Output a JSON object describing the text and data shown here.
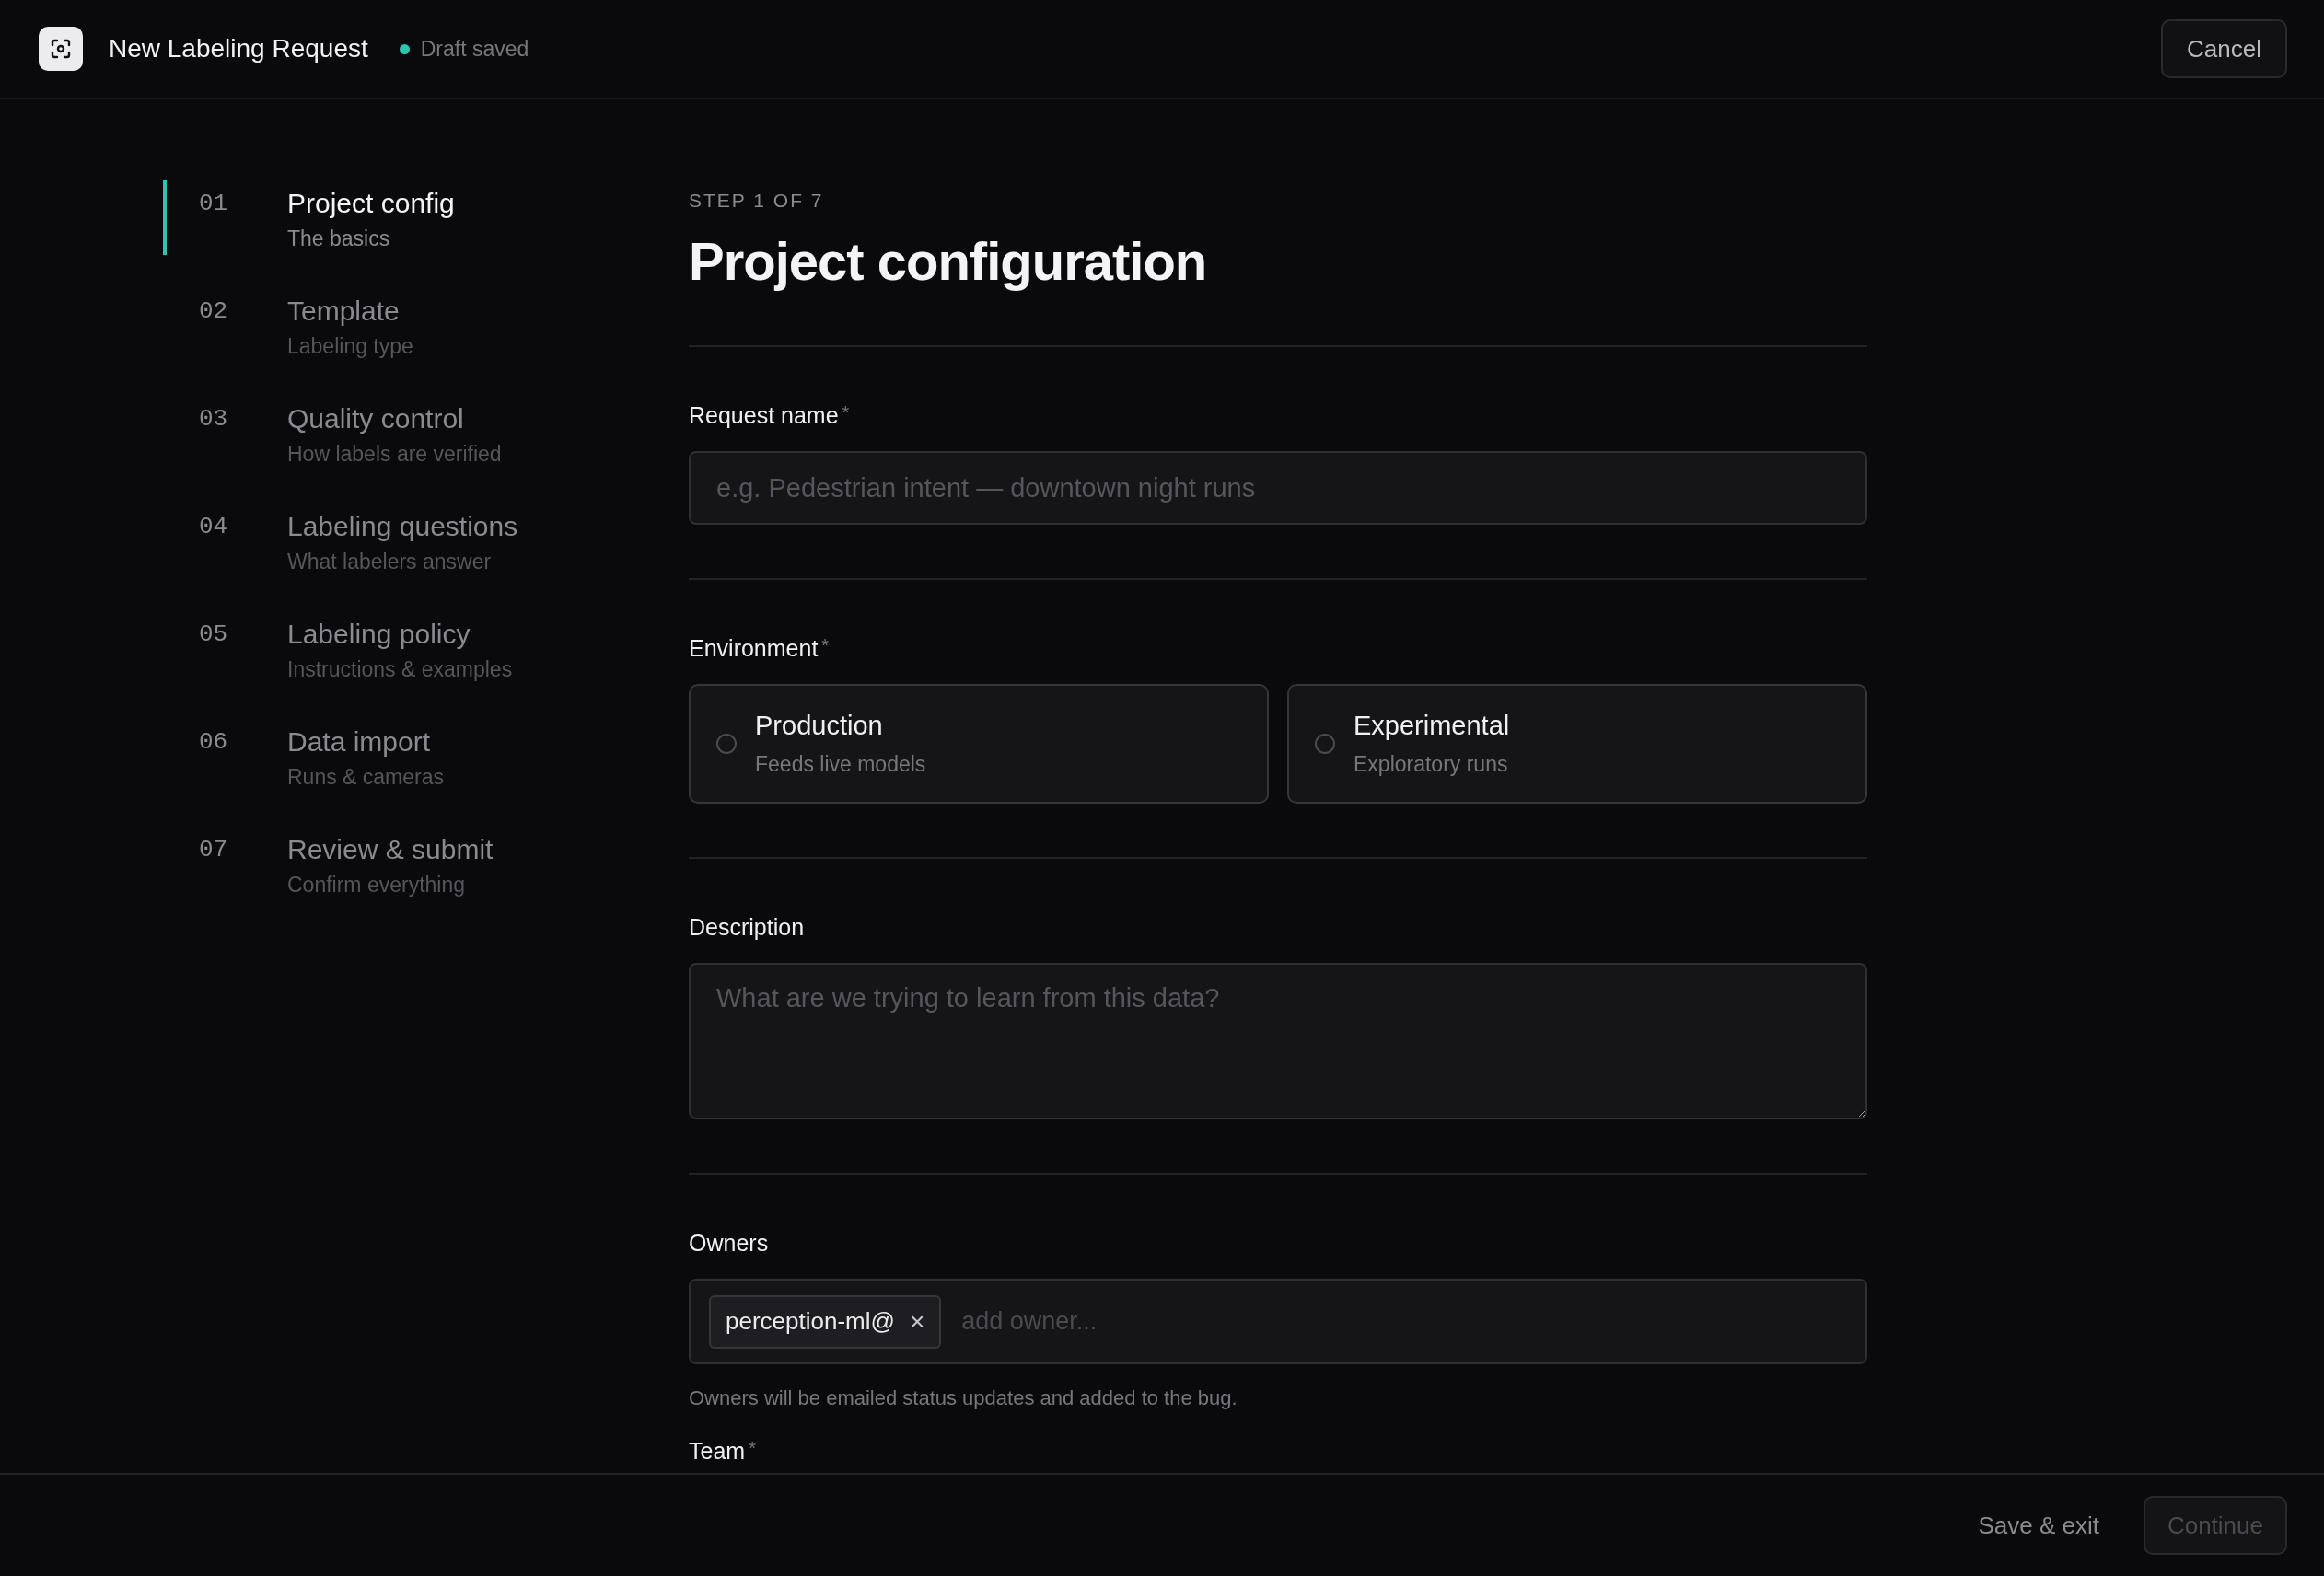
{
  "header": {
    "title": "New Labeling Request",
    "status": "Draft saved",
    "cancel": "Cancel"
  },
  "steps": [
    {
      "number": "01",
      "title": "Project config",
      "subtitle": "The basics",
      "selected": true
    },
    {
      "number": "02",
      "title": "Template",
      "subtitle": "Labeling type",
      "selected": false
    },
    {
      "number": "03",
      "title": "Quality control",
      "subtitle": "How labels are verified",
      "selected": false
    },
    {
      "number": "04",
      "title": "Labeling questions",
      "subtitle": "What labelers answer",
      "selected": false
    },
    {
      "number": "05",
      "title": "Labeling policy",
      "subtitle": "Instructions & examples",
      "selected": false
    },
    {
      "number": "06",
      "title": "Data import",
      "subtitle": "Runs & cameras",
      "selected": false
    },
    {
      "number": "07",
      "title": "Review & submit",
      "subtitle": "Confirm everything",
      "selected": false
    }
  ],
  "form": {
    "eyebrow": "STEP 1 OF 7",
    "title": "Project configuration",
    "sections": [
      {
        "fields": [
          {
            "kind": "text",
            "label": "Request name",
            "required_mark": "*",
            "placeholder": "e.g. Pedestrian intent — downtown night runs"
          }
        ]
      },
      {
        "fields": [
          {
            "kind": "radio",
            "label": "Environment",
            "required_mark": "*",
            "options": [
              {
                "title": "Production",
                "subtitle": "Feeds live models",
                "selected": false
              },
              {
                "title": "Experimental",
                "subtitle": "Exploratory runs",
                "selected": false
              }
            ]
          }
        ]
      },
      {
        "fields": [
          {
            "kind": "textarea",
            "label": "Description",
            "placeholder": "What are we trying to learn from this data?"
          }
        ]
      },
      {
        "fields": [
          {
            "kind": "tags",
            "label": "Owners",
            "tags": [
              {
                "text": "perception-ml@",
                "remove": "×"
              }
            ],
            "placeholder": "add owner...",
            "help": "Owners will be emailed status updates and added to the bug."
          },
          {
            "label": "Team",
            "required_mark": "*"
          }
        ]
      }
    ]
  },
  "footer": {
    "secondary": "Save & exit",
    "primary": {
      "label": "Continue",
      "disabled": true
    }
  }
}
